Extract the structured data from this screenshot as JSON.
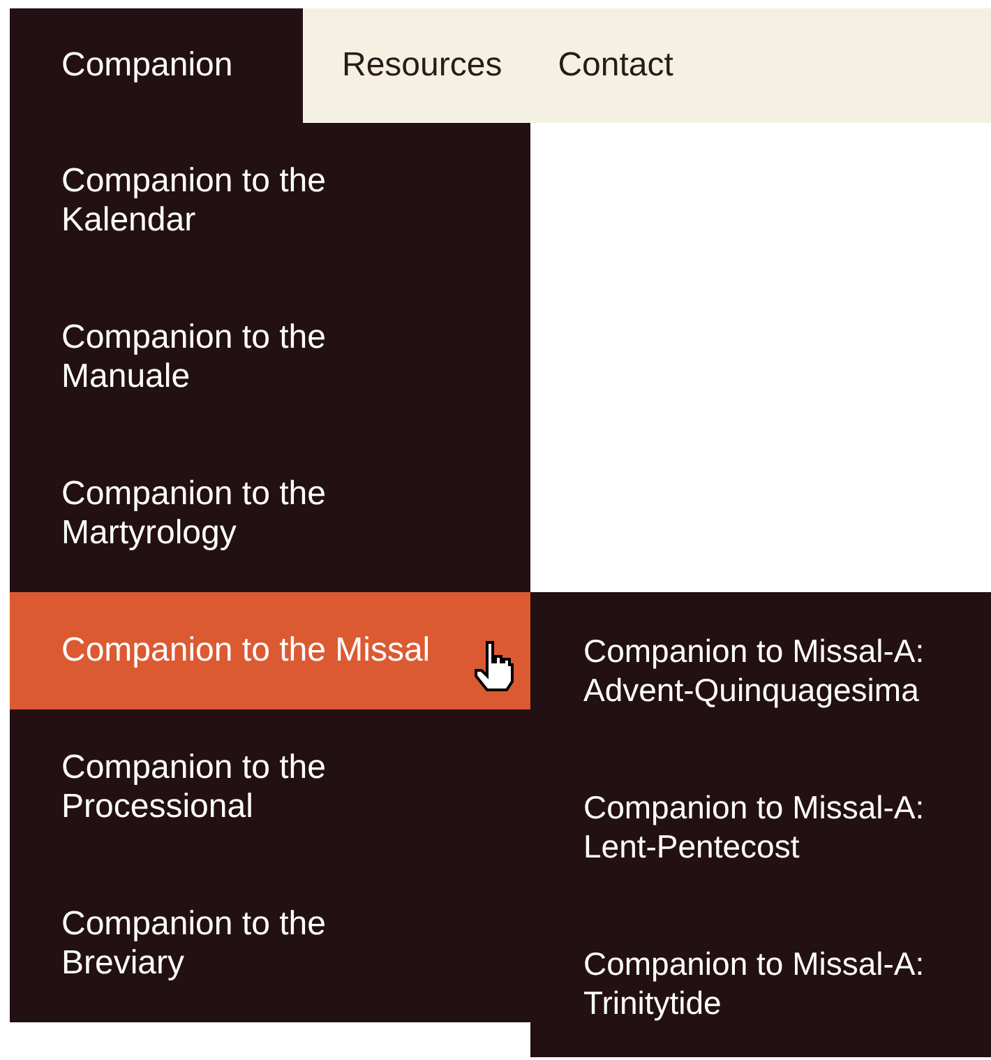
{
  "nav": {
    "tabs": [
      {
        "label": "Companion",
        "selected": true
      },
      {
        "label": "Resources",
        "selected": false
      },
      {
        "label": "Contact",
        "selected": false
      }
    ]
  },
  "dropdown": {
    "items": [
      {
        "label": "Companion to the Kalendar",
        "selected": false
      },
      {
        "label": "Companion to the Manuale",
        "selected": false
      },
      {
        "label": "Companion to the Martyrology",
        "selected": false
      },
      {
        "label": "Companion to the Missal",
        "selected": true
      },
      {
        "label": "Companion to the Processional",
        "selected": false
      },
      {
        "label": "Companion to the Breviary",
        "selected": false
      }
    ]
  },
  "submenu": {
    "items": [
      {
        "label": "Companion to Missal-A: Advent-Quinquagesima"
      },
      {
        "label": "Companion to Missal-A: Lent-Pentecost"
      },
      {
        "label": "Companion to Missal-A: Trinitytide"
      }
    ]
  }
}
